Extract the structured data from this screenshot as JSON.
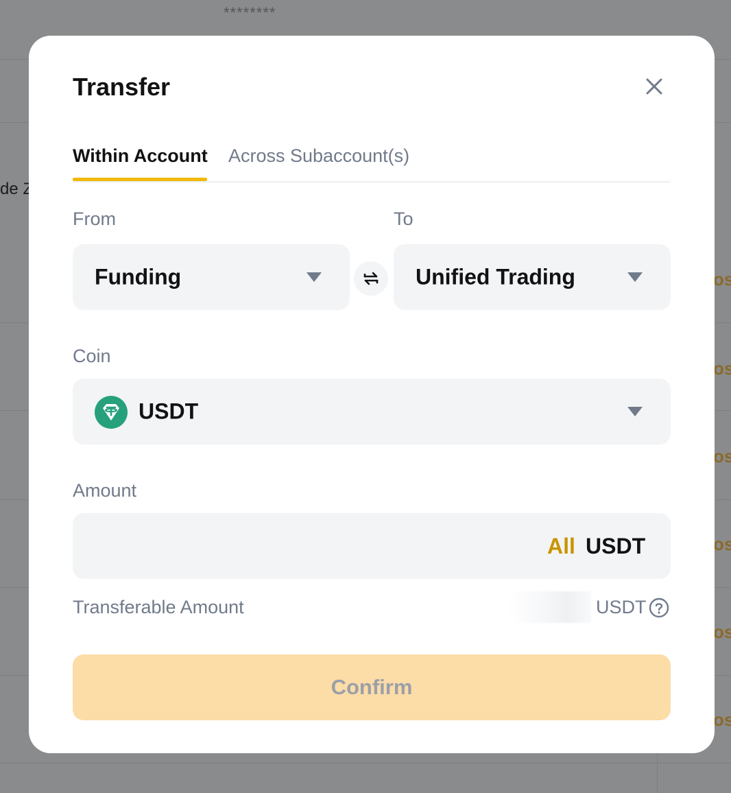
{
  "background": {
    "masked_text": "********",
    "cut_text_left": "de Z",
    "cut_text_right": "osi"
  },
  "modal": {
    "title": "Transfer",
    "close_icon": "close-icon"
  },
  "tabs": [
    {
      "label": "Within Account",
      "active": true
    },
    {
      "label": "Across Subaccount(s)",
      "active": false
    }
  ],
  "from": {
    "label": "From",
    "value": "Funding"
  },
  "to": {
    "label": "To",
    "value": "Unified Trading"
  },
  "swap_icon": "swap-arrows-icon",
  "coin": {
    "label": "Coin",
    "value": "USDT",
    "icon": "tether-icon",
    "icon_color": "#26a17b"
  },
  "amount": {
    "label": "Amount",
    "value": "",
    "all_label": "All",
    "unit": "USDT"
  },
  "transferable": {
    "label": "Transferable Amount",
    "unit": "USDT",
    "help_icon": "question-circle-icon"
  },
  "confirm": {
    "label": "Confirm",
    "color": "#fcdca7"
  },
  "colors": {
    "accent": "#f0b90b",
    "all_link": "#c99400",
    "overlay": "#8a8b8c"
  }
}
